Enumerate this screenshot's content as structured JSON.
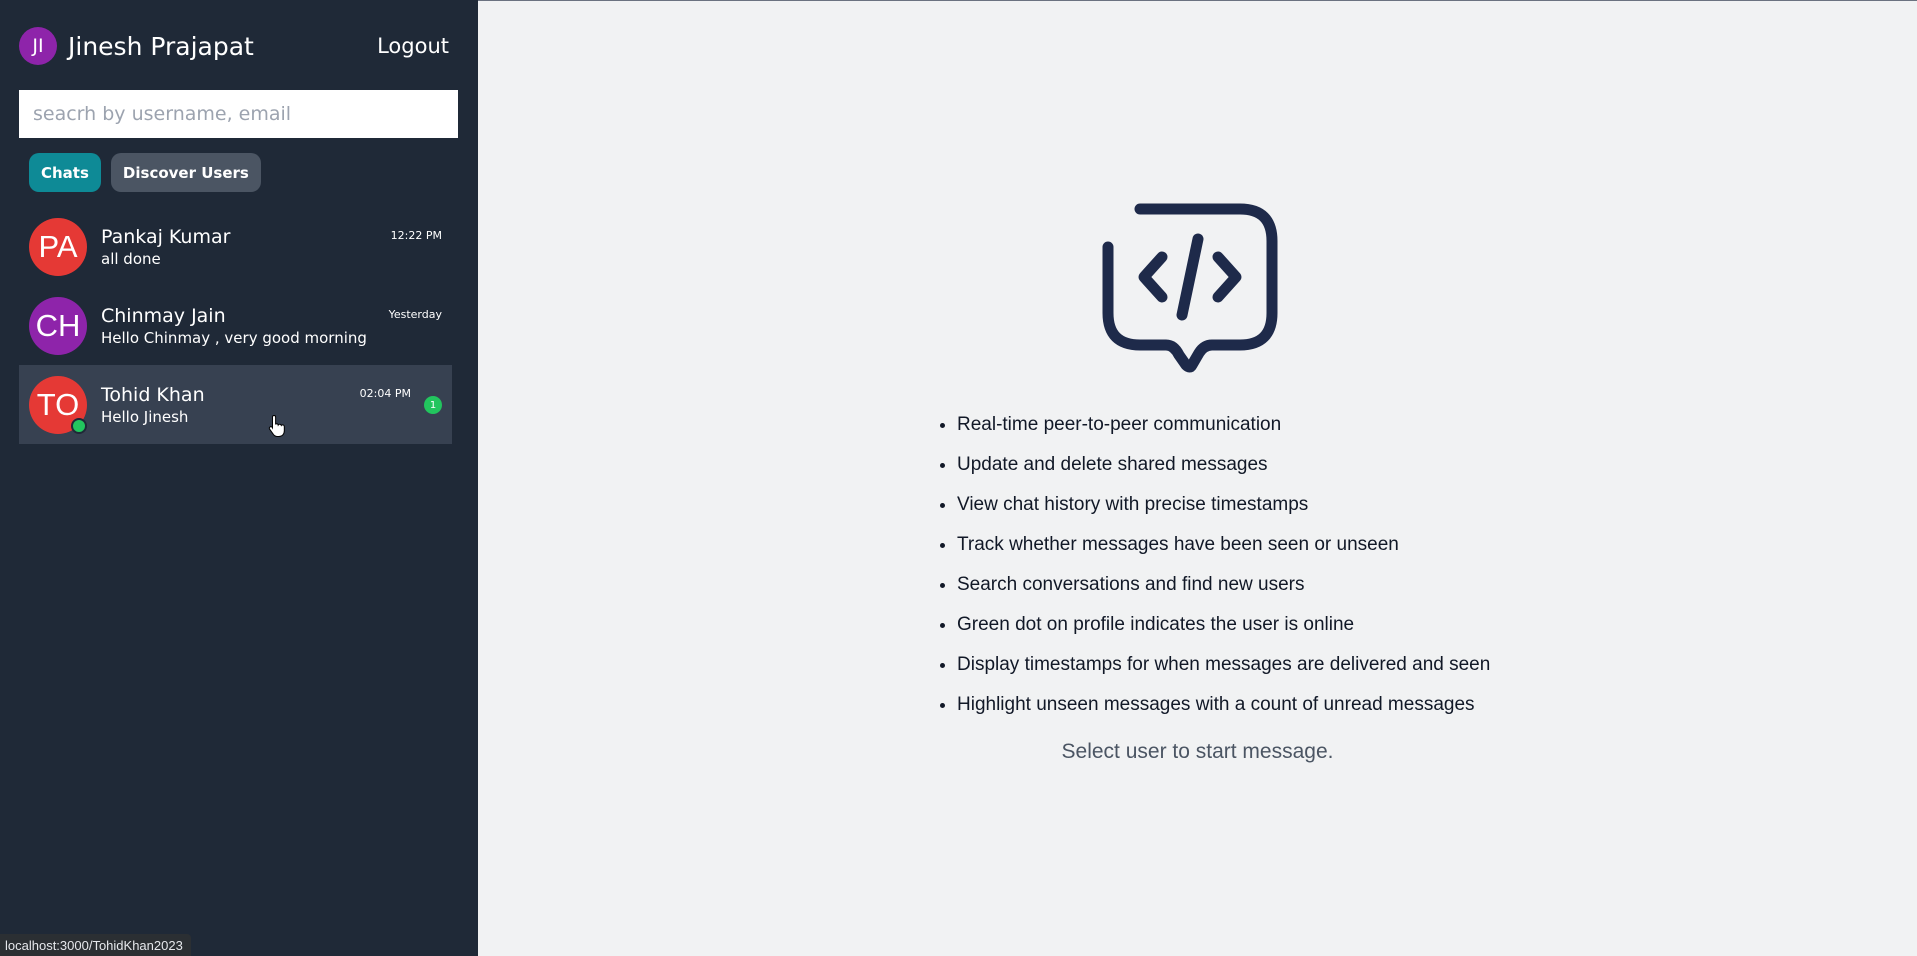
{
  "user": {
    "initials": "JI",
    "name": "Jinesh Prajapat",
    "avatar_color": "#8e24aa"
  },
  "header": {
    "logout_label": "Logout"
  },
  "search": {
    "placeholder": "seacrh by username, email"
  },
  "tabs": [
    {
      "label": "Chats",
      "active": true
    },
    {
      "label": "Discover Users",
      "active": false
    }
  ],
  "chats": [
    {
      "initials": "PA",
      "name": "Pankaj Kumar",
      "last_message": "all done",
      "time": "12:22 PM",
      "avatar_color": "#e53935",
      "online": false,
      "unread": ""
    },
    {
      "initials": "CH",
      "name": "Chinmay Jain",
      "last_message": "Hello Chinmay , very good morning",
      "time": "Yesterday",
      "avatar_color": "#8e24aa",
      "online": false,
      "unread": ""
    },
    {
      "initials": "TO",
      "name": "Tohid Khan",
      "last_message": "Hello Jinesh",
      "time": "02:04 PM",
      "avatar_color": "#e53935",
      "online": true,
      "unread": "1"
    }
  ],
  "features": [
    "Real-time peer-to-peer communication",
    "Update and delete shared messages",
    "View chat history with precise timestamps",
    "Track whether messages have been seen or unseen",
    "Search conversations and find new users",
    "Green dot on profile indicates the user is online",
    "Display timestamps for when messages are delivered and seen",
    "Highlight unseen messages with a count of unread messages"
  ],
  "main": {
    "hint": "Select user to start message.",
    "logo_icon": "code-message-icon"
  },
  "status_bar": {
    "url": "localhost:3000/TohidKhan2023"
  },
  "colors": {
    "sidebar_bg": "#1f2937",
    "active_tab": "#0e8a96",
    "inactive_tab": "#4b5563",
    "online": "#22c55e",
    "main_bg": "#f1f2f3",
    "logo_stroke": "#1e2a4a"
  }
}
